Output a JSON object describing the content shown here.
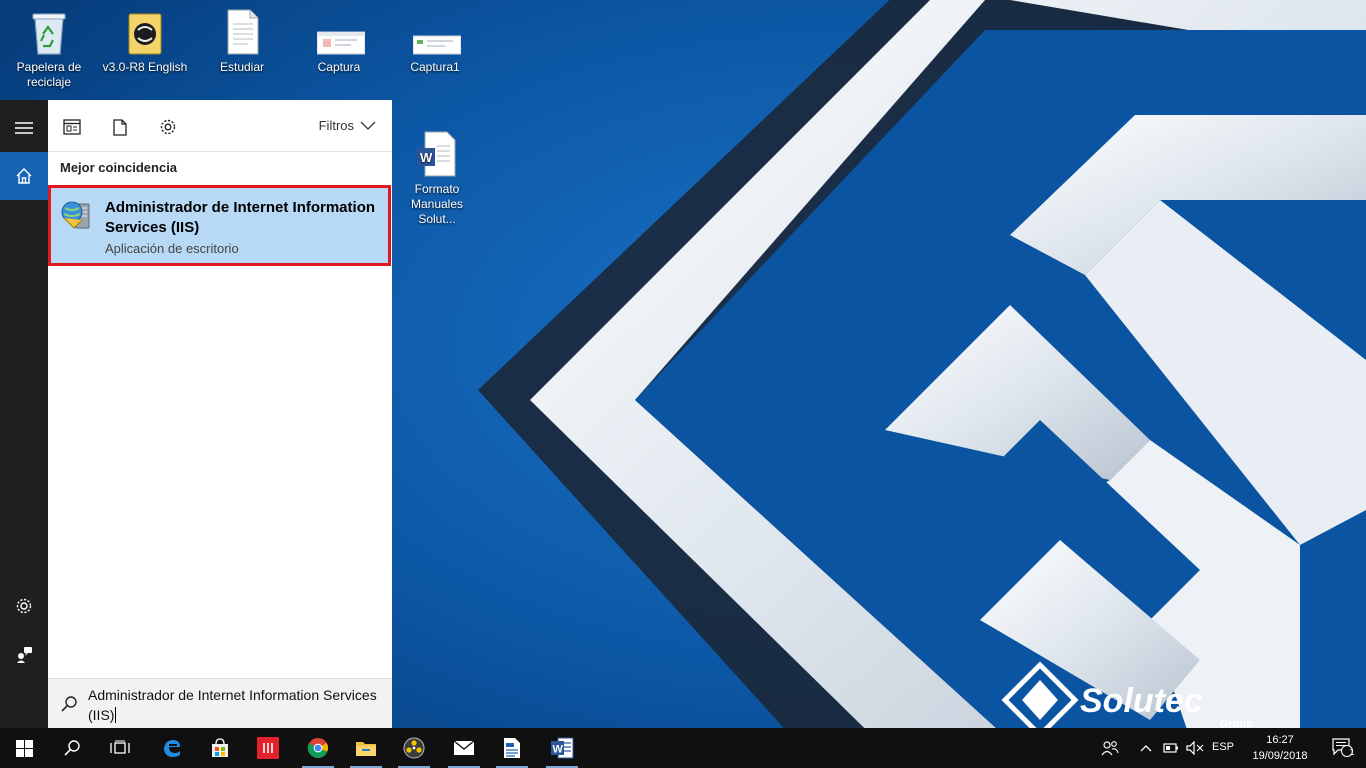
{
  "desktop": {
    "icons": [
      {
        "label": "Papelera de reciclaje",
        "icon": "recycle-bin-icon"
      },
      {
        "label": "v3.0-R8 English",
        "icon": "archive-folder-icon"
      },
      {
        "label": "Estudiar",
        "icon": "document-icon"
      },
      {
        "label": "Captura",
        "icon": "screenshot-thumbnail-icon"
      },
      {
        "label": "Captura1",
        "icon": "screenshot-thumbnail-icon"
      },
      {
        "label": "Formato Manuales Solut...",
        "icon": "word-document-icon"
      }
    ],
    "wallpaper_brand": {
      "name": "Solutec",
      "sub": "Group"
    }
  },
  "start_menu": {
    "rail": {
      "items": [
        {
          "name": "menu",
          "icon": "hamburger-icon"
        },
        {
          "name": "home",
          "icon": "home-icon",
          "active": true
        },
        {
          "name": "settings",
          "icon": "gear-icon"
        },
        {
          "name": "feedback",
          "icon": "feedback-icon"
        }
      ]
    },
    "toolbar": {
      "icons": [
        "apps-icon",
        "documents-icon",
        "settings-icon"
      ],
      "filters_label": "Filtros"
    },
    "best_match": {
      "heading": "Mejor coincidencia",
      "title": "Administrador de Internet Information Services (IIS)",
      "subtitle": "Aplicación de escritorio",
      "icon": "iis-manager-icon"
    },
    "search": {
      "value": "Administrador de Internet Information Services (IIS)"
    }
  },
  "taskbar": {
    "apps": [
      "windows-start-icon",
      "search-icon",
      "task-view-icon",
      "edge-icon",
      "store-icon",
      "red-app-icon",
      "chrome-icon",
      "file-explorer-icon",
      "media-app-icon",
      "mail-icon",
      "document-app-icon",
      "word-icon"
    ],
    "tray": {
      "language": "ESP",
      "time": "16:27",
      "date": "19/09/2018",
      "notification_count": "1"
    }
  },
  "colors": {
    "accent": "#1565b3",
    "selection": "#b7d9f6",
    "highlight_border": "#e0171f"
  }
}
